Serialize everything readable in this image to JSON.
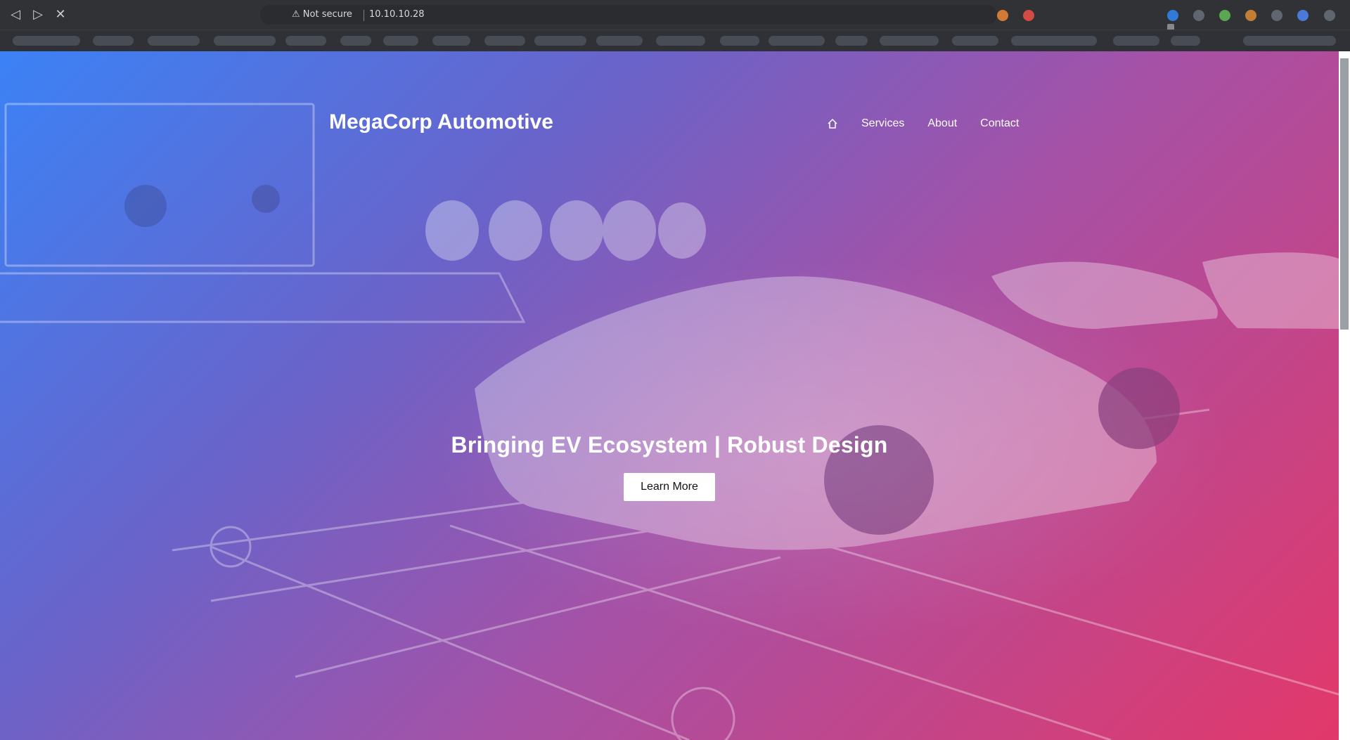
{
  "browser": {
    "security_text": "Not secure",
    "url": "10.10.10.28"
  },
  "site": {
    "brand": "MegaCorp Automotive",
    "nav": {
      "home_icon": "home-icon",
      "items": [
        "Services",
        "About",
        "Contact"
      ]
    },
    "hero": {
      "title": "Bringing EV Ecosystem | Robust Design",
      "button": "Learn More"
    }
  }
}
